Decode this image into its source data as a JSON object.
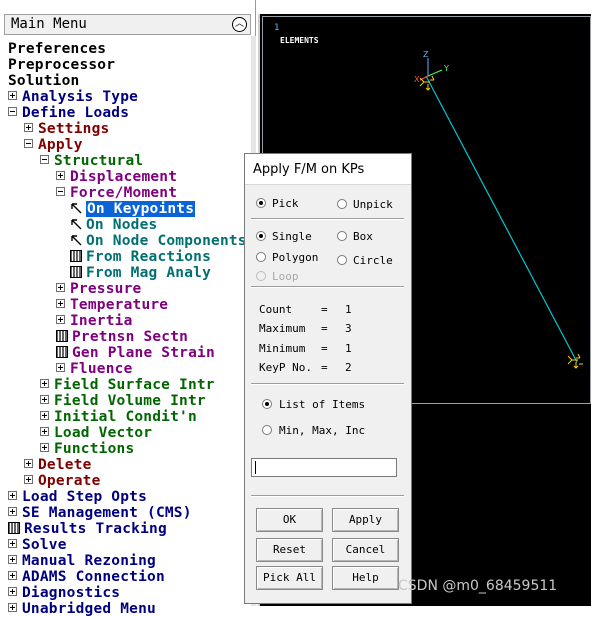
{
  "menu": {
    "title": "Main Menu",
    "items": [
      {
        "label": "Preferences",
        "expander": "none"
      },
      {
        "label": "Preprocessor",
        "expander": "none"
      },
      {
        "label": "Solution",
        "expander": "none"
      },
      {
        "label": "Analysis Type",
        "expander": "plus"
      },
      {
        "label": "Define Loads",
        "expander": "minus"
      },
      {
        "label": "Settings",
        "expander": "plus"
      },
      {
        "label": "Apply",
        "expander": "minus"
      },
      {
        "label": "Structural",
        "expander": "minus"
      },
      {
        "label": "Displacement",
        "expander": "plus"
      },
      {
        "label": "Force/Moment",
        "expander": "minus"
      },
      {
        "label": "On Keypoints",
        "icon": "pick-arrow-icon",
        "selected": true
      },
      {
        "label": "On Nodes",
        "icon": "pick-arrow-icon"
      },
      {
        "label": "On Node Components",
        "icon": "pick-arrow-icon"
      },
      {
        "label": "From Reactions",
        "icon": "calculator-icon"
      },
      {
        "label": "From Mag Analy",
        "icon": "calculator-icon"
      },
      {
        "label": "Pressure",
        "expander": "plus"
      },
      {
        "label": "Temperature",
        "expander": "plus"
      },
      {
        "label": "Inertia",
        "expander": "plus"
      },
      {
        "label": "Pretnsn Sectn",
        "icon": "calculator-icon"
      },
      {
        "label": "Gen Plane Strain",
        "icon": "calculator-icon"
      },
      {
        "label": "Fluence",
        "expander": "plus"
      },
      {
        "label": "Field Surface Intr",
        "expander": "plus"
      },
      {
        "label": "Field Volume Intr",
        "expander": "plus"
      },
      {
        "label": "Initial Condit'n",
        "expander": "plus"
      },
      {
        "label": "Load Vector",
        "expander": "plus"
      },
      {
        "label": "Functions",
        "expander": "plus"
      },
      {
        "label": "Delete",
        "expander": "plus"
      },
      {
        "label": "Operate",
        "expander": "plus"
      },
      {
        "label": "Load Step Opts",
        "expander": "plus"
      },
      {
        "label": "SE Management (CMS)",
        "expander": "plus"
      },
      {
        "label": "Results Tracking",
        "icon": "calculator-icon"
      },
      {
        "label": "Solve",
        "expander": "plus"
      },
      {
        "label": "Manual Rezoning",
        "expander": "plus"
      },
      {
        "label": "ADAMS Connection",
        "expander": "plus"
      },
      {
        "label": "Diagnostics",
        "expander": "plus"
      },
      {
        "label": "Unabridged Menu",
        "expander": "plus"
      }
    ]
  },
  "graphics": {
    "window_number": "1",
    "label": "ELEMENTS",
    "axis_z": "Z",
    "axis_y": "Y",
    "axis_x": "X",
    "line_color": "#00c8d0",
    "marker_color": "#ffd000"
  },
  "dialog": {
    "title": "Apply F/M on KPs",
    "pick": "Pick",
    "unpick": "Unpick",
    "single": "Single",
    "box": "Box",
    "polygon": "Polygon",
    "circle": "Circle",
    "loop": "Loop",
    "count_label": "Count",
    "count_value": "1",
    "maximum_label": "Maximum",
    "maximum_value": "3",
    "minimum_label": "Minimum",
    "minimum_value": "1",
    "keyp_label": "KeyP No.",
    "keyp_value": "2",
    "eq": "=",
    "list_of_items": "List of Items",
    "min_max_inc": "Min, Max, Inc",
    "entry_value": "",
    "ok": "OK",
    "apply": "Apply",
    "reset": "Reset",
    "cancel": "Cancel",
    "pick_all": "Pick All",
    "help": "Help"
  },
  "watermark": "CSDN @m0_68459511"
}
